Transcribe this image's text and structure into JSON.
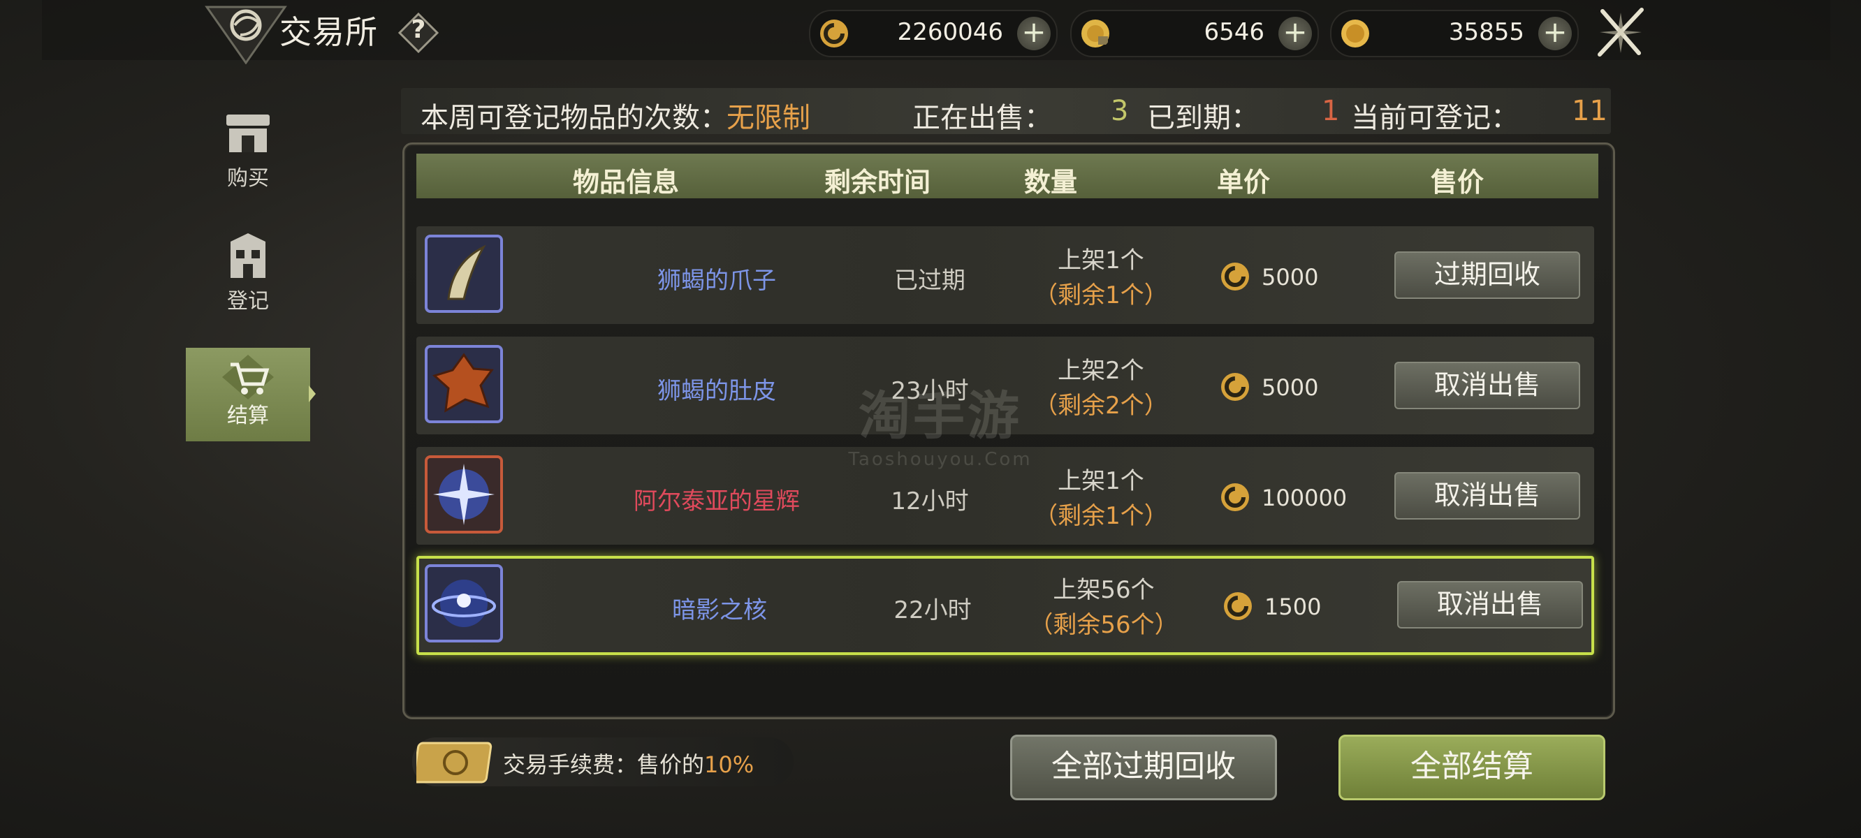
{
  "header": {
    "title": "交易所",
    "help_label": "?",
    "currencies": [
      {
        "name": "silver-coin",
        "value": "2260046",
        "plus": "+"
      },
      {
        "name": "locked-gold-coin",
        "value": "6546",
        "plus": "+"
      },
      {
        "name": "gold-coin",
        "value": "35855",
        "plus": "+"
      }
    ]
  },
  "sidebar": {
    "items": [
      {
        "label": "购买",
        "icon": "shop-icon"
      },
      {
        "label": "登记",
        "icon": "register-icon"
      },
      {
        "label": "结算",
        "icon": "cart-icon"
      }
    ],
    "active": "结算"
  },
  "info": {
    "weekly_label": "本周可登记物品的次数：",
    "weekly_value": "无限制",
    "selling_label": "正在出售：",
    "selling_value": "3",
    "expired_label": "已到期：",
    "expired_value": "1",
    "available_label": "当前可登记：",
    "available_value": "11"
  },
  "table": {
    "headers": [
      "物品信息",
      "剩余时间",
      "数量",
      "单价",
      "售价"
    ],
    "rows": [
      {
        "name": "狮蝎的爪子",
        "name_color": "#7d95e8",
        "time": "已过期",
        "listed": "上架1个",
        "remain": "（剩余1个）",
        "price": "5000",
        "action": "过期回收",
        "selected": false
      },
      {
        "name": "狮蝎的肚皮",
        "name_color": "#7d95e8",
        "time": "23小时",
        "listed": "上架2个",
        "remain": "（剩余2个）",
        "price": "5000",
        "action": "取消出售",
        "selected": false
      },
      {
        "name": "阿尔泰亚的星辉",
        "name_color": "#e04a5c",
        "time": "12小时",
        "listed": "上架1个",
        "remain": "（剩余1个）",
        "price": "100000",
        "action": "取消出售",
        "selected": false
      },
      {
        "name": "暗影之核",
        "name_color": "#7d95e8",
        "time": "22小时",
        "listed": "上架56个",
        "remain": "（剩余56个）",
        "price": "1500",
        "action": "取消出售",
        "selected": true
      }
    ]
  },
  "footer": {
    "fee_label": "交易手续费：售价的",
    "fee_value": "10%",
    "reclaim_all": "全部过期回收",
    "settle_all": "全部结算"
  },
  "watermark": {
    "main": "淘手游",
    "sub": "Taoshouyou.Com"
  }
}
